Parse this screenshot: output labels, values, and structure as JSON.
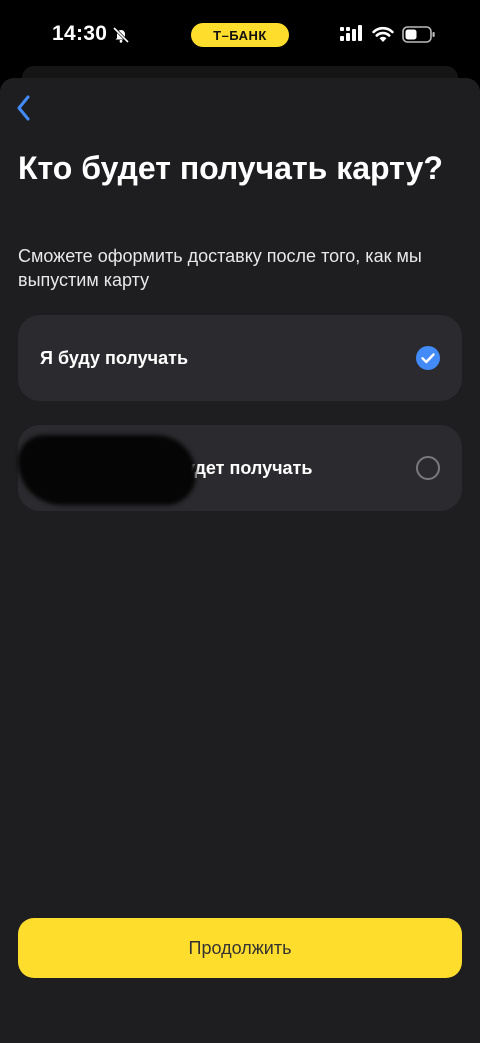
{
  "status_bar": {
    "time": "14:30",
    "carrier_badge": "Т–БАНК",
    "icons": [
      "bell-off-icon",
      "cellular-signal-icon",
      "wifi-icon",
      "battery-icon"
    ]
  },
  "header": {
    "back_icon": "chevron-left-icon"
  },
  "main": {
    "title": "Кто будет получать карту?",
    "subtitle": "Сможете оформить доставку после того, как мы выпустим карту",
    "options": [
      {
        "label": "Я буду получать",
        "selected": true
      },
      {
        "label": "будет получать",
        "selected": false
      }
    ]
  },
  "footer": {
    "continue_label": "Продолжить"
  },
  "colors": {
    "accent_yellow": "#FFDD2D",
    "radio_blue": "#428BF9",
    "sheet_background": "#1E1E20",
    "card_background": "#2B2B2F"
  }
}
